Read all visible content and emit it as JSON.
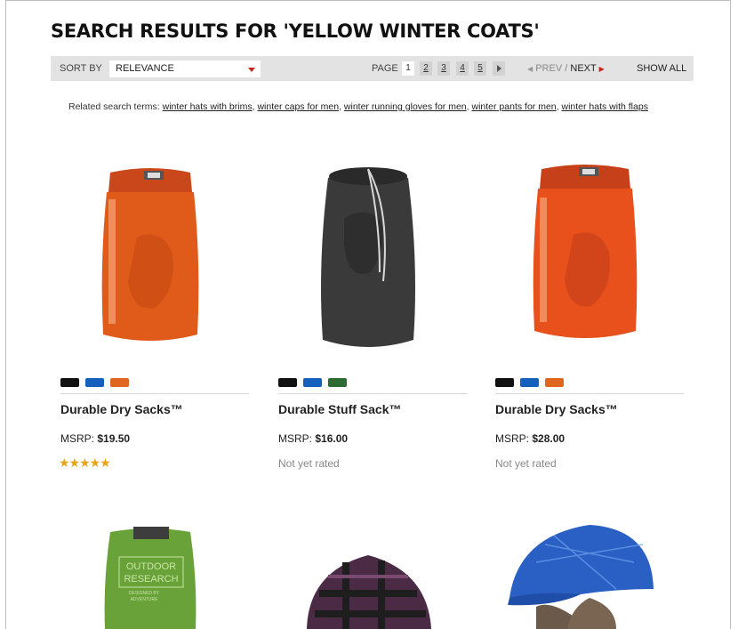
{
  "page": {
    "title": "SEARCH RESULTS FOR 'YELLOW WINTER COATS'"
  },
  "toolbar": {
    "sort_label": "SORT BY",
    "sort_value": "RELEVANCE",
    "page_label": "PAGE",
    "pages": [
      "1",
      "2",
      "3",
      "4",
      "5"
    ],
    "current_page": "1",
    "prev_label": "PREV",
    "separator": "/",
    "next_label": "NEXT",
    "show_all_label": "SHOW ALL"
  },
  "related": {
    "label": "Related search terms:",
    "terms": [
      "winter hats with brims",
      "winter caps for men",
      "winter running gloves for men",
      "winter pants for men",
      "winter hats with flaps"
    ]
  },
  "products": [
    {
      "name": "Durable Dry Sacks™",
      "msrp_label": "MSRP:",
      "price": "$19.50",
      "rating": 5,
      "rating_text": "",
      "swatches": [
        "#111111",
        "#1560bd",
        "#e0661f"
      ],
      "image_color": "#e05a1a"
    },
    {
      "name": "Durable Stuff Sack™",
      "msrp_label": "MSRP:",
      "price": "$16.00",
      "rating": 0,
      "rating_text": "Not yet rated",
      "swatches": [
        "#111111",
        "#1560bd",
        "#2e6b34"
      ],
      "image_color": "#3a3a3a"
    },
    {
      "name": "Durable Dry Sacks™",
      "msrp_label": "MSRP:",
      "price": "$28.00",
      "rating": 0,
      "rating_text": "Not yet rated",
      "swatches": [
        "#111111",
        "#1560bd",
        "#e0661f"
      ],
      "image_color": "#e8501c"
    }
  ],
  "row2_images": [
    {
      "color": "#6aa23a",
      "kind": "green-dry-sack",
      "printed_text": "OUTDOOR RESEARCH DESIGNED BY ADVENTURE"
    },
    {
      "color": "#4a2a44",
      "kind": "plaid-cap"
    },
    {
      "color": "#2a5fc4",
      "kind": "blue-cap"
    }
  ],
  "colors": {
    "toolbar_bg": "#e3e3e3",
    "accent_red": "#c8261c",
    "star_gold": "#e8a317"
  }
}
